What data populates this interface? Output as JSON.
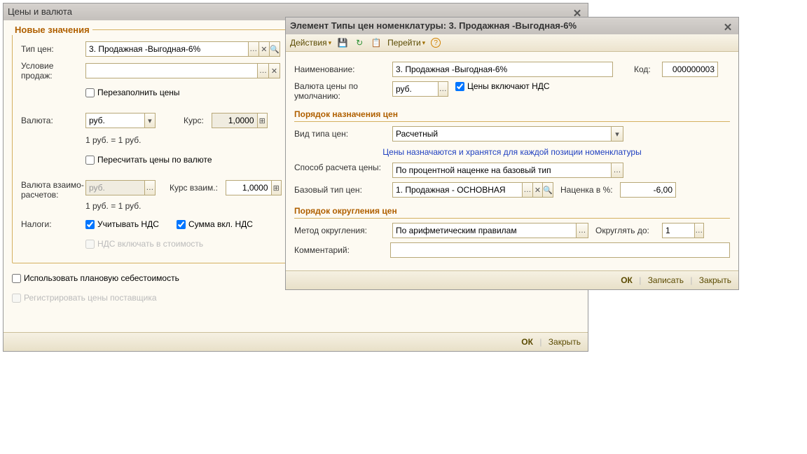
{
  "win1": {
    "title": "Цены и валюта",
    "group": "Новые значения",
    "price_type_label": "Тип цен:",
    "price_type_value": "3. Продажная -Выгодная-6%",
    "condition_label": "Условие продаж:",
    "condition_value": "",
    "refill_label": "Перезаполнить цены",
    "currency_label": "Валюта:",
    "currency_value": "руб.",
    "rate_label": "Курс:",
    "rate_value": "1,0000",
    "rate_hint": "1 руб. = 1 руб.",
    "recalc_label": "Пересчитать цены по валюте",
    "mutcurr_label": "Валюта взаимо-расчетов:",
    "mutcurr_value": "руб.",
    "mutrate_label": "Курс взаим.:",
    "mutrate_value": "1,0000",
    "mutrate_hint": "1 руб. = 1 руб.",
    "taxes_label": "Налоги:",
    "tax_vat_label": "Учитывать НДС",
    "tax_sum_label": "Сумма вкл. НДС",
    "tax_incl_label": "НДС включать в стоимость",
    "use_plan_label": "Использовать плановую себестоимость",
    "reg_supplier_label": "Регистрировать цены поставщика",
    "ok": "ОК",
    "close": "Закрыть"
  },
  "win2": {
    "title": "Элемент Типы цен номенклатуры: 3. Продажная -Выгодная-6%",
    "actions": "Действия",
    "goto": "Перейти",
    "name_label": "Наименование:",
    "name_value": "3. Продажная -Выгодная-6%",
    "code_label": "Код:",
    "code_value": "000000003",
    "defcurr_label": "Валюта цены по умолчанию:",
    "defcurr_value": "руб.",
    "incvat_label": "Цены включают НДС",
    "section1": "Порядок назначения цен",
    "kind_label": "Вид типа цен:",
    "kind_value": "Расчетный",
    "hint": "Цены назначаются и хранятся для каждой позиции номенклатуры",
    "method_label": "Способ расчета цены:",
    "method_value": "По процентной наценке на базовый тип",
    "base_label": "Базовый тип цен:",
    "base_value": "1. Продажная - ОСНОВНАЯ",
    "markup_label": "Наценка в %:",
    "markup_value": "-6,00",
    "section2": "Порядок округления цен",
    "round_label": "Метод округления:",
    "round_value": "По арифметическим правилам",
    "roundto_label": "Округлять до:",
    "roundto_value": "1",
    "comment_label": "Комментарий:",
    "comment_value": "",
    "ok": "ОК",
    "save": "Записать",
    "close": "Закрыть"
  }
}
